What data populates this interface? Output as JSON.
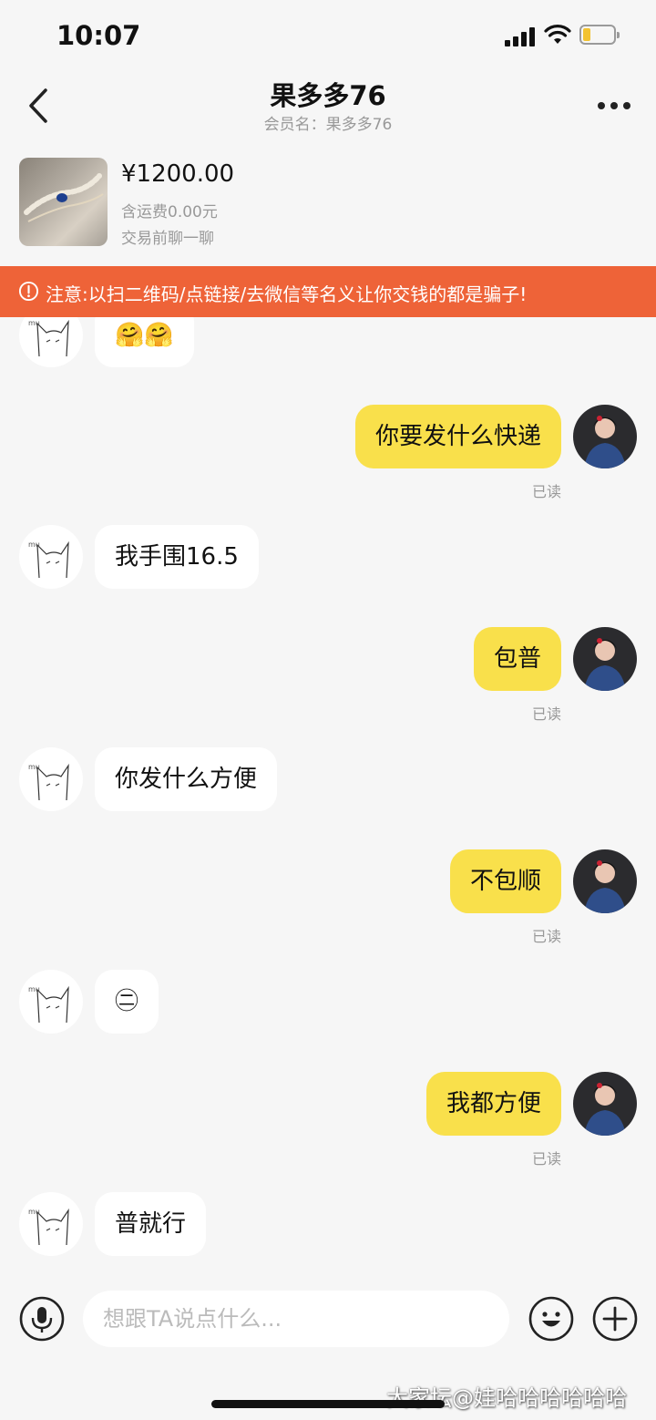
{
  "status_bar": {
    "time": "10:07",
    "battery_color": "#f2c230"
  },
  "header": {
    "title": "果多多76",
    "subtitle": "会员名：果多多76",
    "back_icon": "chevron-left-icon",
    "more_icon": "more-dots-icon"
  },
  "product": {
    "price": "¥1200.00",
    "shipping": "含运费0.00元",
    "chat_note": "交易前聊一聊"
  },
  "warning": {
    "text": "注意:以扫二维码/点链接/去微信等名义让你交钱的都是骗子!",
    "color": "#ee6338"
  },
  "messages": [
    {
      "from": "them",
      "text": "🤗🤗"
    },
    {
      "from": "me",
      "text": "你要发什么快递",
      "status": "已读"
    },
    {
      "from": "them",
      "text": "我手围16.5"
    },
    {
      "from": "me",
      "text": "包普",
      "status": "已读"
    },
    {
      "from": "them",
      "text": "你发什么方便"
    },
    {
      "from": "me",
      "text": "不包顺",
      "status": "已读"
    },
    {
      "from": "them",
      "text": "㊁"
    },
    {
      "from": "me",
      "text": "我都方便",
      "status": "已读"
    },
    {
      "from": "them",
      "text": "普就行"
    }
  ],
  "input": {
    "placeholder": "想跟TA说点什么...",
    "voice_icon": "microphone-icon",
    "emoji_icon": "emoji-icon",
    "add_icon": "plus-icon"
  },
  "watermark": "大家坛@娃哈哈哈哈哈哈",
  "colors": {
    "outgoing_bubble": "#f9e04b",
    "incoming_bubble": "#ffffff",
    "background": "#f6f6f6"
  }
}
